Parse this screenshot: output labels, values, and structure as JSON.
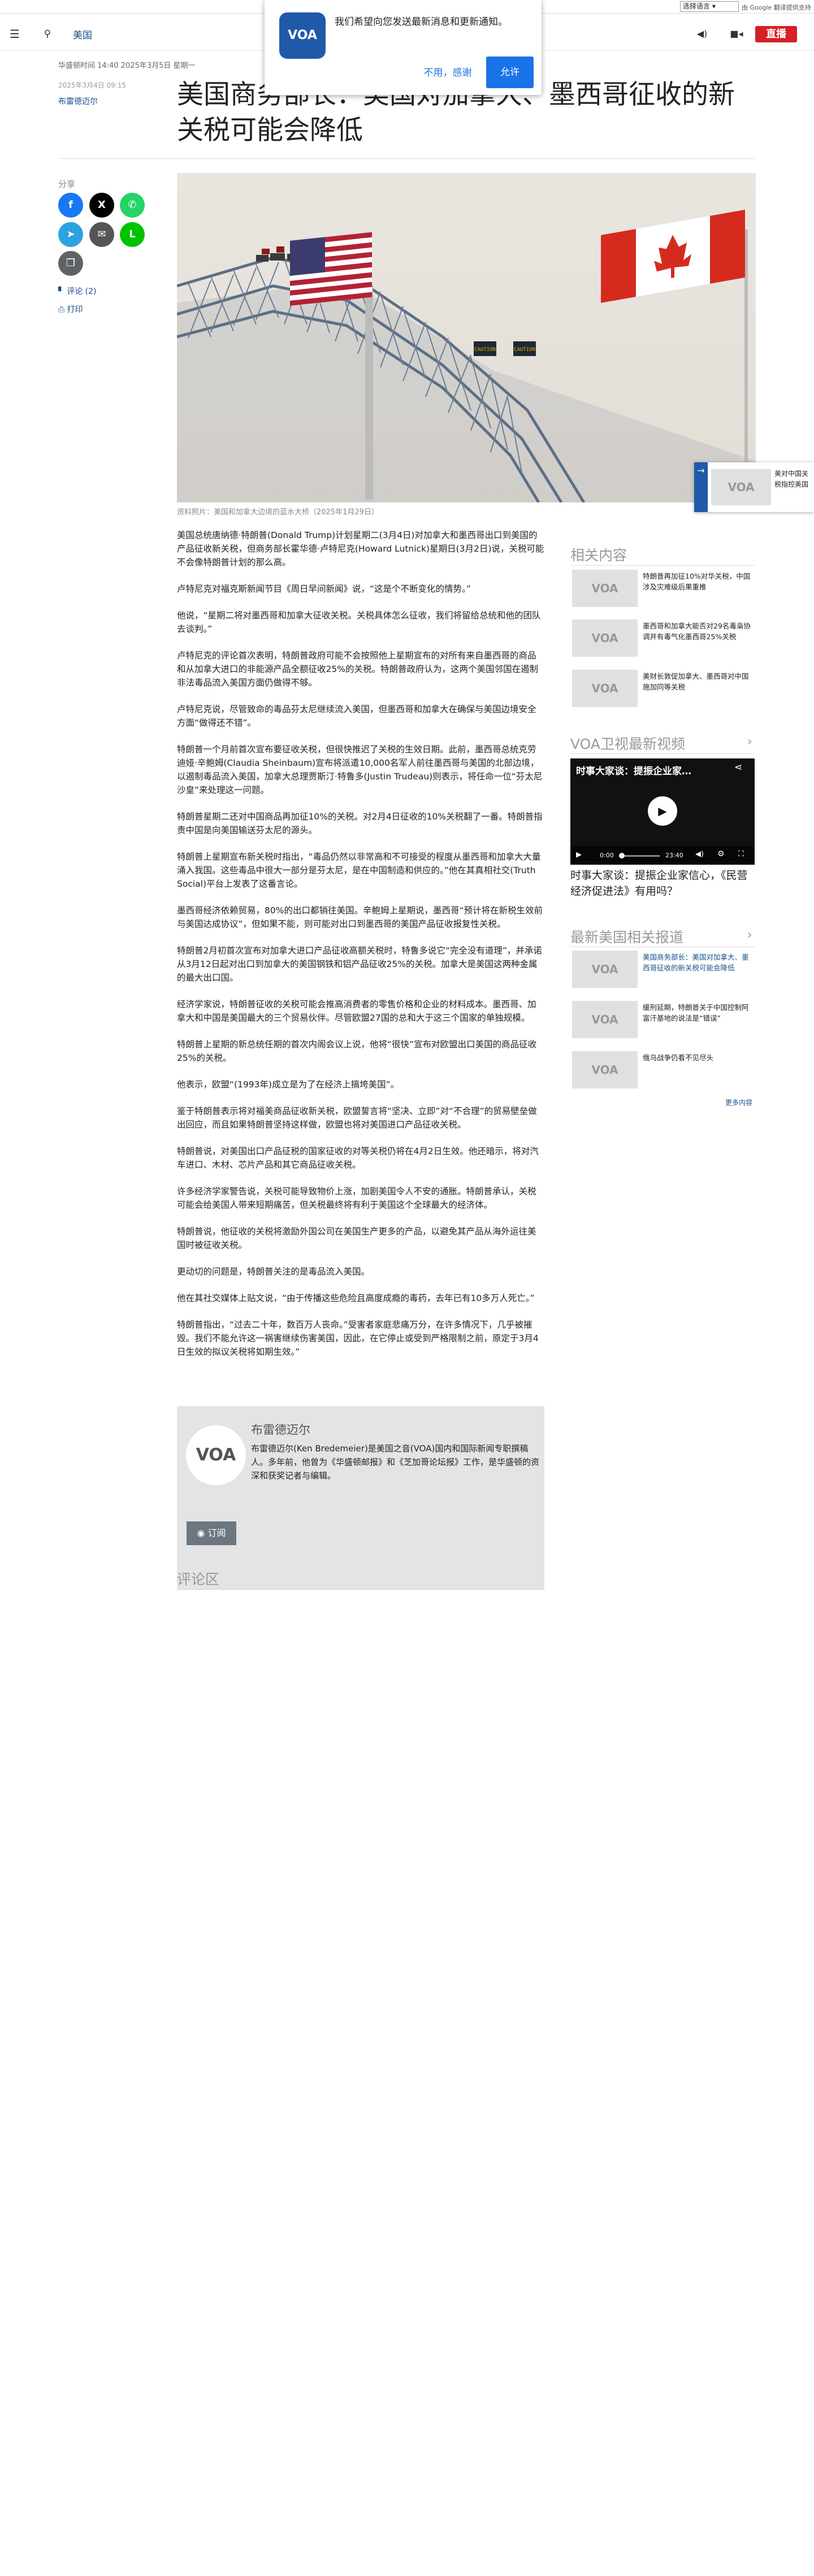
{
  "topbar": {
    "language_select": "选择语言",
    "gtranslate": "由 Google 翻译提供支持"
  },
  "nav": {
    "section": "美国",
    "live_label": "直播",
    "menu_icon": "hamburger-icon",
    "search_icon": "search-icon",
    "audio_icon": "speaker-icon",
    "video_icon": "video-camera-icon"
  },
  "notification": {
    "logo": "VOA",
    "message": "我们希望向您发送最新消息和更新通知。",
    "deny": "不用，感谢",
    "allow": "允许"
  },
  "article": {
    "dateline": "华盛顿时间 14:40 2025年3月5日 星期一",
    "published": "2025年3月4日 09:15",
    "author": "布雷德迈尔",
    "title": "美国商务部长：美国对加拿大、墨西哥征收的新关税可能会降低",
    "share_label": "分享",
    "comments_link": "评论 (2)",
    "print_link": "打印",
    "caption": "资料照片：美国和加拿大边境的蓝水大桥（2025年1月29日）",
    "hero_sign": "CAUTION",
    "paragraphs": [
      "美国总统唐纳德·特朗普(Donald Trump)计划星期二(3月4日)对加拿大和墨西哥出口到美国的产品征收新关税，但商务部长霍华德·卢特尼克(Howard Lutnick)星期日(3月2日)说，关税可能不会像特朗普计划的那么高。",
      "卢特尼克对福克斯新闻节目《周日早间新闻》说，“这是个不断变化的情势。”",
      "他说，“星期二将对墨西哥和加拿大征收关税。关税具体怎么征收，我们将留给总统和他的团队去谈判。”",
      "卢特尼克的评论首次表明，特朗普政府可能不会按照他上星期宣布的对所有来自墨西哥的商品和从加拿大进口的非能源产品全额征收25%的关税。特朗普政府认为，这两个美国邻国在遏制非法毒品流入美国方面仍做得不够。",
      "卢特尼克说，尽管致命的毒品芬太尼继续流入美国，但墨西哥和加拿大在确保与美国边境安全方面“做得还不错”。",
      "特朗普一个月前首次宣布要征收关税，但很快推迟了关税的生效日期。此前，墨西哥总统克劳迪娅·辛鲍姆(Claudia Sheinbaum)宣布将派遣10,000名军人前往墨西哥与美国的北部边境，以遏制毒品流入美国，加拿大总理贾斯汀·特鲁多(Justin Trudeau)则表示，将任命一位“芬太尼沙皇”来处理这一问题。",
      "特朗普星期二还对中国商品再加征10%的关税。对2月4日征收的10%关税翻了一番。特朗普指责中国是向美国输送芬太尼的源头。",
      "特朗普上星期宣布新关税时指出，“毒品仍然以非常高和不可接受的程度从墨西哥和加拿大大量涌入我国。这些毒品中很大一部分是芬太尼，是在中国制造和供应的。”他在其真相社交(Truth Social)平台上发表了这番言论。",
      "墨西哥经济依赖贸易，80%的出口都销往美国。辛鲍姆上星期说，墨西哥“预计将在新税生效前与美国达成协议”，但如果不能，则可能对出口到墨西哥的美国产品征收报复性关税。",
      "特朗普2月初首次宣布对加拿大进口产品征收高额关税时，特鲁多说它“完全没有道理”，并承诺从3月12日起对出口到加拿大的美国钢铁和铝产品征收25%的关税。加拿大是美国这两种金属的最大出口国。",
      "经济学家说，特朗普征收的关税可能会推高消费者的零售价格和企业的材料成本。墨西哥、加拿大和中国是美国最大的三个贸易伙伴。尽管欧盟27国的总和大于这三个国家的单独规模。",
      "特朗普上星期的新总统任期的首次内阁会议上说，他将“很快”宣布对欧盟出口美国的商品征收25%的关税。",
      "他表示，欧盟“(1993年)成立是为了在经济上搞垮美国”。",
      "鉴于特朗普表示将对福美商品征收新关税，欧盟誓言将“坚决、立即”对“不合理”的贸易壁垒做出回应，而且如果特朗普坚持这样做，欧盟也将对美国进口产品征收关税。",
      "特朗普说，对美国出口产品征税的国家征收的对等关税仍将在4月2日生效。他还暗示，将对汽车进口、木材、芯片产品和其它商品征收关税。",
      "许多经济学家警告说，关税可能导致物价上涨，加剧美国令人不安的通胀。特朗普承认，关税可能会给美国人带来短期痛苦，但关税最终将有利于美国这个全球最大的经济体。",
      "特朗普说，他征收的关税将激励外国公司在美国生产更多的产品，以避免其产品从海外运往美国时被征收关税。",
      "更动切的问题是，特朗普关注的是毒品流入美国。",
      "他在其社交媒体上贴文说，“由于传播这些危险且高度成瘾的毒药，去年已有10多万人死亡。”",
      "特朗普指出，“过去二十年，数百万人丧命。”受害者家庭悲痛万分，在许多情况下，几乎被摧毁。我们不能允许这一祸害继续伤害美国，因此，在它停止或受到严格限制之前，原定于3月4日生效的拟议关税将如期生效。”"
    ]
  },
  "author_bio": {
    "logo": "VOA",
    "name": "布雷德迈尔",
    "text": "布雷德迈尔(Ken Bredemeier)是美国之音(VOA)国内和国际新闻专职撰稿人。多年前，他曾为《华盛顿邮报》和《芝加哥论坛报》工作，是华盛顿的资深和获奖记者与编辑。",
    "subscribe": "订阅"
  },
  "comments": {
    "heading": "评论区"
  },
  "sidebar": {
    "related_heading": "相关内容",
    "related": [
      {
        "thumb": "VOA",
        "title": "特朗普再加征10%对华关税，中国涉及灾难级后果重推"
      },
      {
        "thumb": "VOA",
        "title": "墨西哥和加拿大能否对29名毒枭协调并有毒气化墨西哥25%关税"
      },
      {
        "thumb": "VOA",
        "title": "美财长敦促加拿大、墨西哥对中国施加同等关税"
      }
    ],
    "video_heading": "VOA卫视最新视频",
    "video": {
      "overlay_title": "时事大家谈：提振企业家…",
      "time_current": "0:00",
      "time_total": "23:40",
      "title": "时事大家谈：提振企业家信心，《民营经济促进法》有用吗？"
    },
    "latest_heading": "最新美国相关报道",
    "latest": [
      {
        "thumb": "VOA",
        "title": "美国商务部长：美国对加拿大、墨西哥征收的新关税可能会降低"
      },
      {
        "thumb": "VOA",
        "title": "缓刑延期，特朗普关于中国控制阿富汗基地的说法是“错误”"
      },
      {
        "thumb": "VOA",
        "title": "俄乌战争仍看不见尽头"
      }
    ],
    "more_link": "更多内容"
  },
  "sticky": {
    "thumb": "VOA",
    "title": "美对中国关税指控美国"
  },
  "colors": {
    "brand_blue": "#1e5aa8",
    "live_red": "#d61f26",
    "link_blue": "#1a4f8a",
    "facebook": "#1877f2",
    "x": "#000000",
    "whatsapp": "#25d366",
    "telegram": "#2aa3df",
    "email": "#555555",
    "line": "#00c300",
    "copy": "#5f6368"
  }
}
